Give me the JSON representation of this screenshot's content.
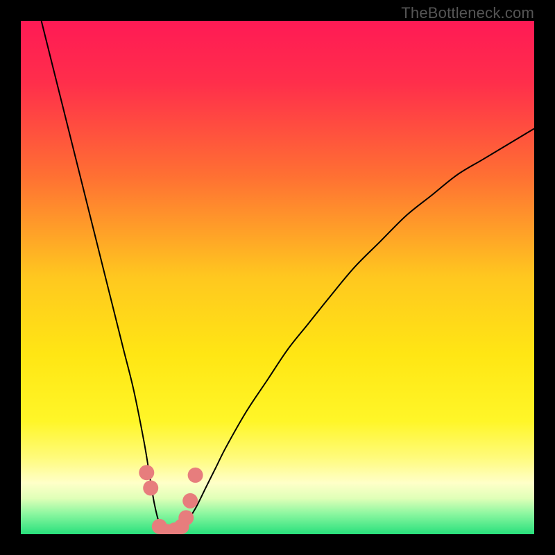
{
  "watermark": "TheBottleneck.com",
  "chart_data": {
    "type": "line",
    "title": "",
    "xlabel": "",
    "ylabel": "",
    "xlim": [
      0,
      100
    ],
    "ylim": [
      0,
      100
    ],
    "grid": false,
    "legend": false,
    "background_gradient": {
      "stops": [
        {
          "offset": 0.0,
          "color": "#ff1a55"
        },
        {
          "offset": 0.12,
          "color": "#ff2e4b"
        },
        {
          "offset": 0.3,
          "color": "#ff6f33"
        },
        {
          "offset": 0.5,
          "color": "#ffc81f"
        },
        {
          "offset": 0.65,
          "color": "#ffe614"
        },
        {
          "offset": 0.78,
          "color": "#fff628"
        },
        {
          "offset": 0.85,
          "color": "#fffb7a"
        },
        {
          "offset": 0.9,
          "color": "#ffffc8"
        },
        {
          "offset": 0.93,
          "color": "#e0ffb8"
        },
        {
          "offset": 0.96,
          "color": "#8cf7a0"
        },
        {
          "offset": 1.0,
          "color": "#28e07c"
        }
      ]
    },
    "series": [
      {
        "name": "bottleneck-curve",
        "color": "#000000",
        "width": 2,
        "x": [
          4,
          6,
          8,
          10,
          12,
          14,
          16,
          18,
          20,
          22,
          24,
          25,
          26,
          27,
          28,
          29,
          30,
          32,
          34,
          36,
          38,
          40,
          44,
          48,
          52,
          56,
          60,
          65,
          70,
          75,
          80,
          85,
          90,
          95,
          100
        ],
        "y": [
          100,
          92,
          84,
          76,
          68,
          60,
          52,
          44,
          36,
          28,
          18,
          12,
          6,
          2,
          0,
          0,
          0,
          2,
          5,
          9,
          13,
          17,
          24,
          30,
          36,
          41,
          46,
          52,
          57,
          62,
          66,
          70,
          73,
          76,
          79
        ]
      },
      {
        "name": "highlight-dots",
        "color": "#e77d7d",
        "type": "scatter",
        "radius": 11,
        "x": [
          24.5,
          25.3,
          27.0,
          28.5,
          30.0,
          31.3,
          32.2,
          33.0,
          34.0
        ],
        "y": [
          12.0,
          9.0,
          1.5,
          0.5,
          0.8,
          1.5,
          3.2,
          6.5,
          11.5
        ]
      }
    ]
  }
}
